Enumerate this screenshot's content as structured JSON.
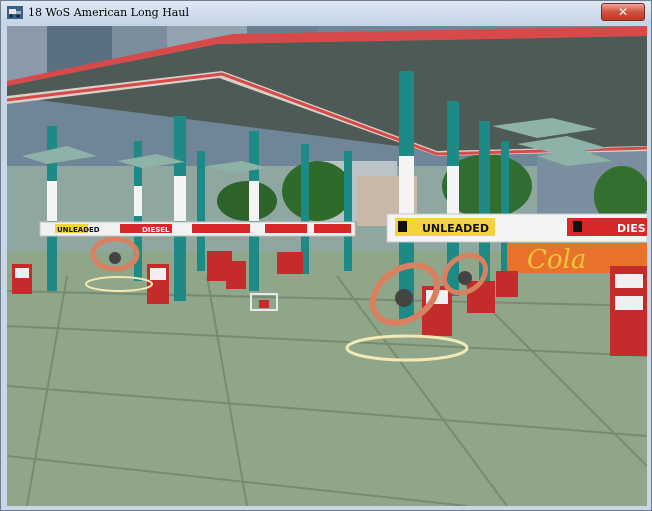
{
  "window": {
    "title": "18 WoS American Long Haul",
    "close_glyph": "✕"
  },
  "icons": {
    "app": "truck-app-icon",
    "close": "close-icon"
  },
  "scene": {
    "signs": {
      "left_unleaded": "UNLEADED",
      "left_diesel": "DIESEL",
      "right_unleaded": "UNLEADED",
      "right_diesel": "DIES",
      "billboard": "Cola"
    },
    "colors": {
      "canopy": "#4d5a55",
      "canopy_trim": "#d84a4a",
      "pillar": "#1e8a86",
      "ground": "#8fa68a",
      "pump": "#c42b2b",
      "sign_yellow": "#f3d23a"
    }
  }
}
